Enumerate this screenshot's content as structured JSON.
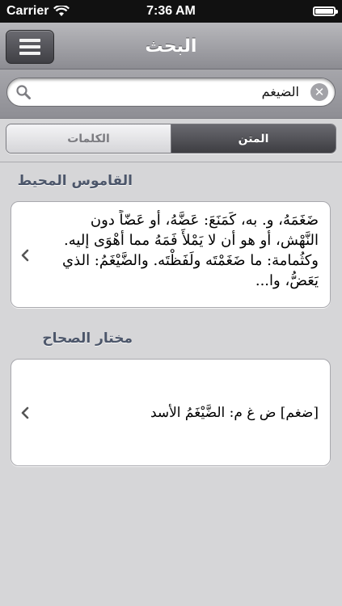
{
  "status_bar": {
    "carrier": "Carrier",
    "time": "7:36 AM",
    "battery_level": 1.0
  },
  "nav": {
    "title": "البحث",
    "menu_icon": "hamburger-icon"
  },
  "search": {
    "value": "الضيغم",
    "icon": "search-icon",
    "clear_icon": "clear-icon"
  },
  "tabs": [
    {
      "label": "الكلمات",
      "selected": false
    },
    {
      "label": "المتن",
      "selected": true
    }
  ],
  "results": [
    {
      "source": "القاموس المحيط",
      "text": "ضَغَمَهُ، و. به، كَمَنَعَ: عَضَّهُ، أو عَضّاً دون النَّهْش، أو هو أن لا يَمْلأَ فَمَهُ مما أهْوَى إليه. وكثُمامة: ما ضَغَمْتَه ولَفَظْتَه. والضَّيْغَمُ: الذي يَعَضُّ، وا..."
    },
    {
      "source": "مختار الصحاح",
      "text": "[ضغم] ض غ م: الضَّيْغَمُ الأسد"
    }
  ],
  "colors": {
    "background": "#d6d6d8",
    "section_header": "#4c566a",
    "nav_gradient_top": "#b8b8bc",
    "nav_gradient_bottom": "#8c8c92"
  }
}
